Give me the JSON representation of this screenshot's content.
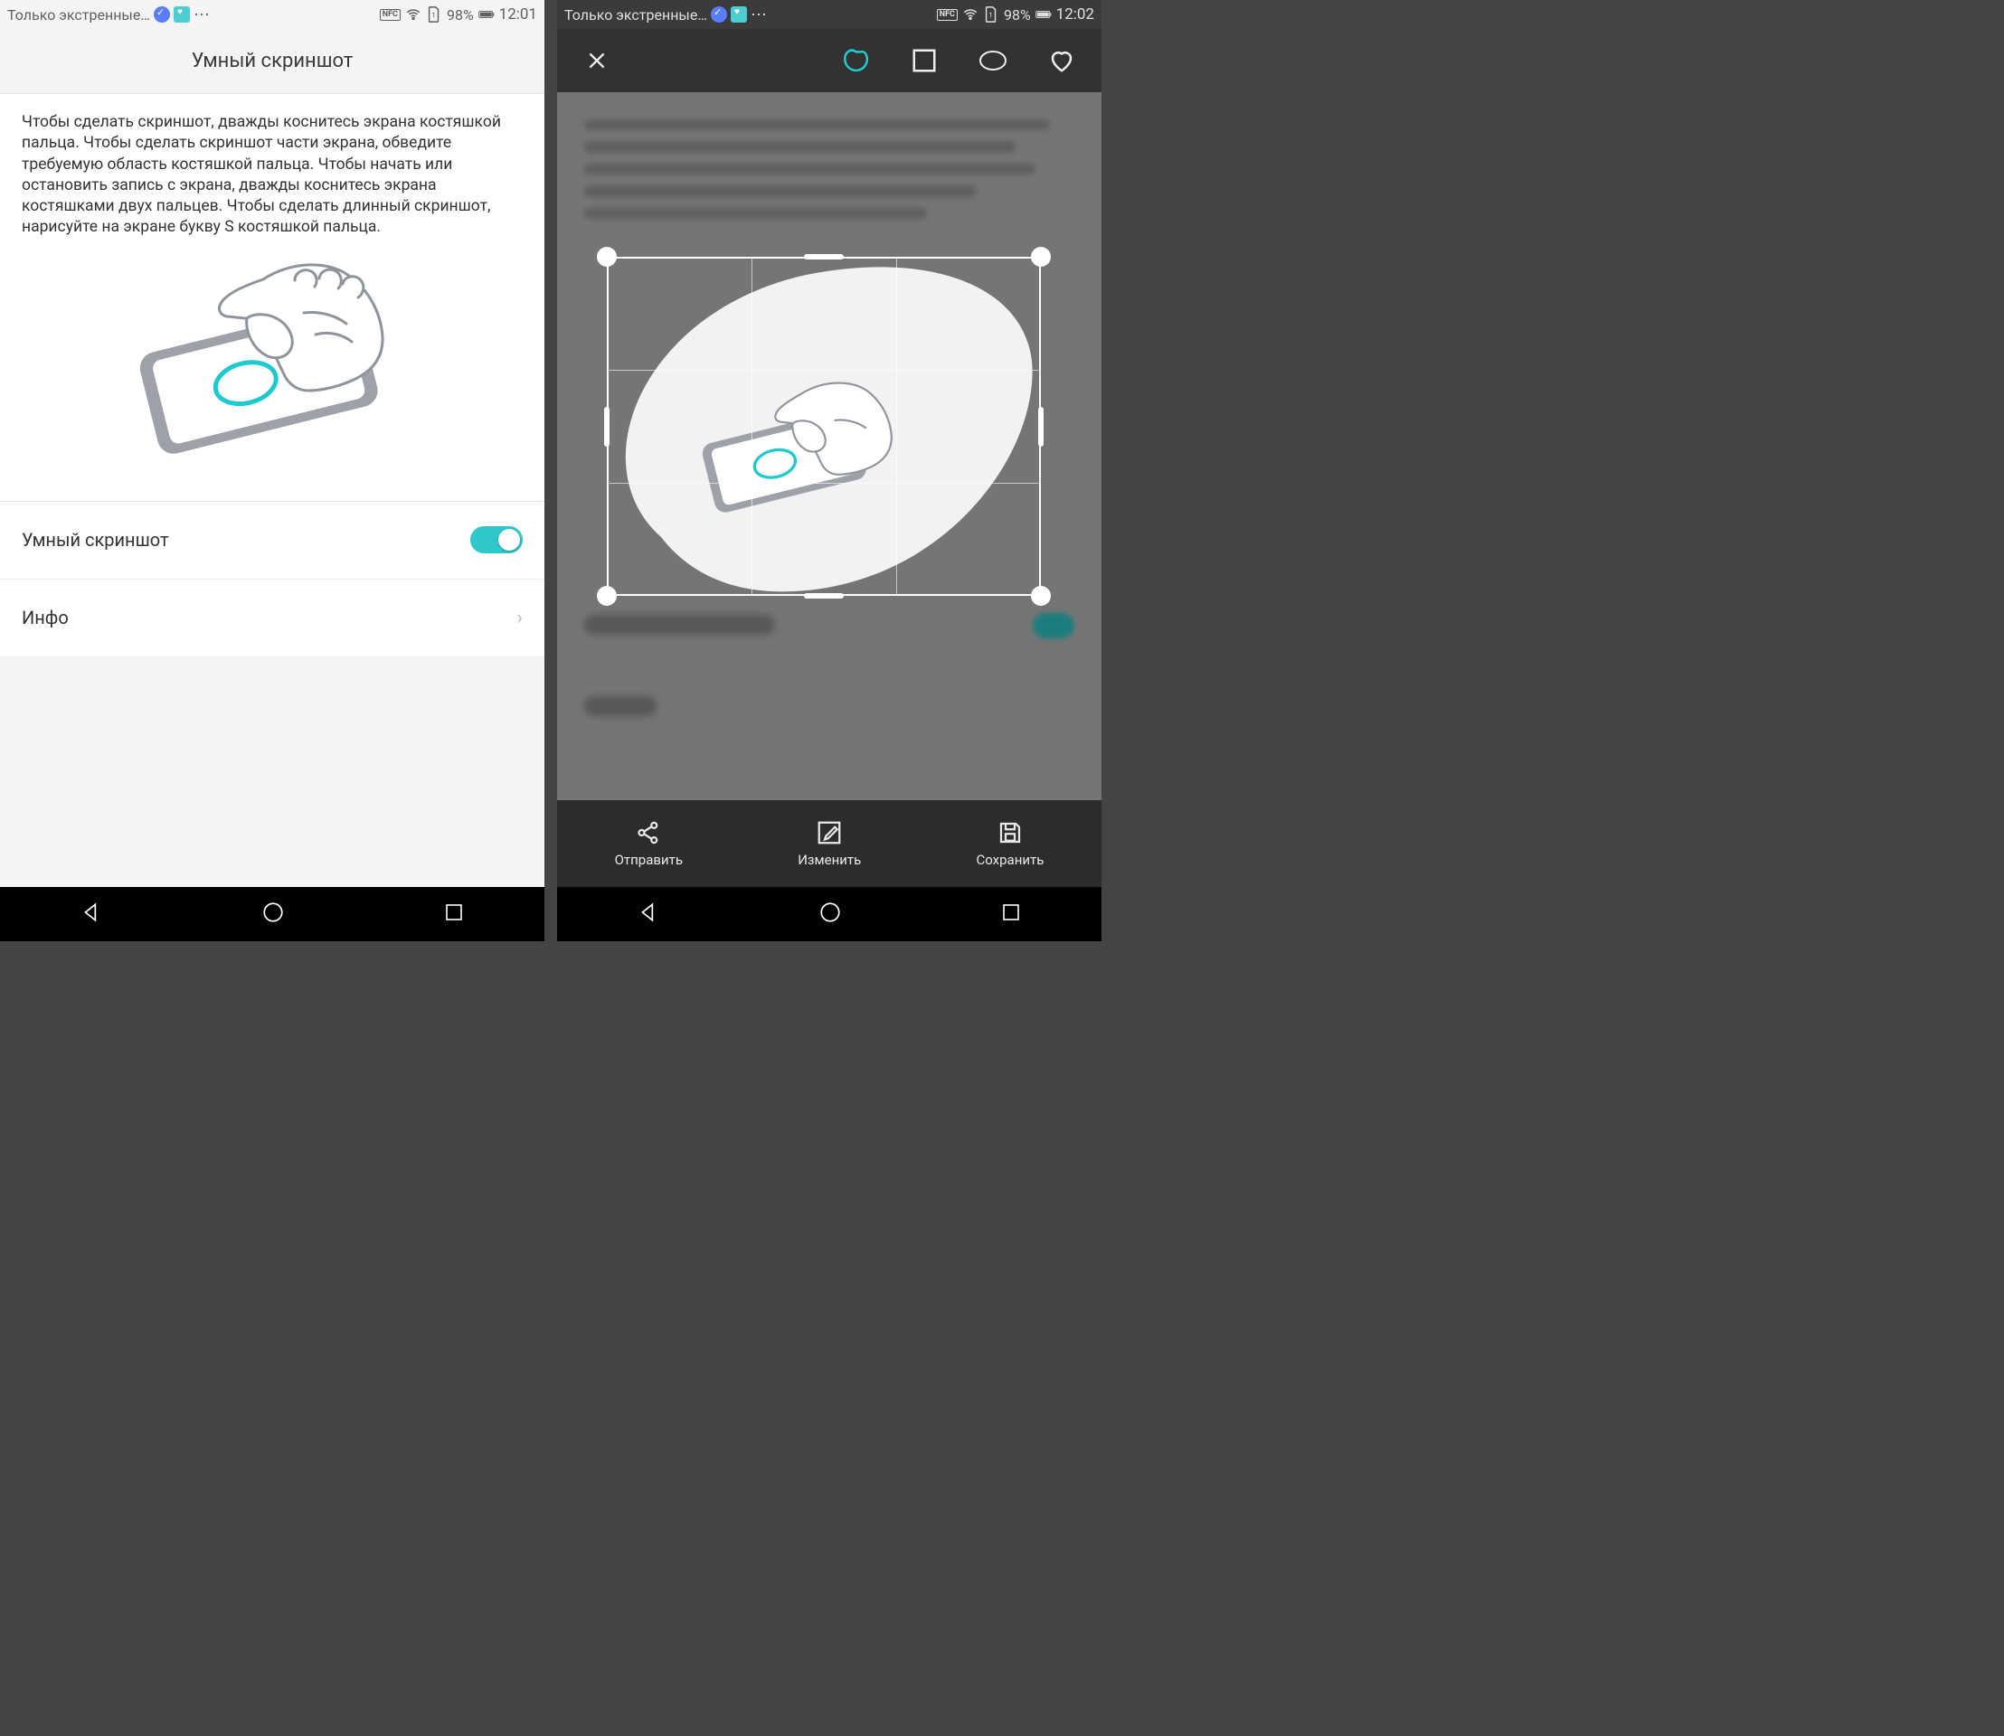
{
  "left": {
    "status": {
      "carrier": "Только экстренные…",
      "nfc": "NFC",
      "battery": "98%",
      "time": "12:01"
    },
    "header": {
      "title": "Умный скриншот"
    },
    "description": "Чтобы сделать скриншот, дважды коснитесь экрана костяшкой пальца. Чтобы сделать скриншот части экрана, обведите требуемую область костяшкой пальца. Чтобы начать или остановить запись с экрана, дважды коснитесь экрана костяшками двух пальцев. Чтобы сделать длинный скриншот, нарисуйте на экране букву S костяшкой пальца.",
    "rows": {
      "toggle_label": "Умный скриншот",
      "toggle_on": true,
      "info_label": "Инфо"
    }
  },
  "right": {
    "status": {
      "carrier": "Только экстренные…",
      "nfc": "NFC",
      "battery": "98%",
      "time": "12:02"
    },
    "toolbar": {
      "close_icon": "close",
      "shapes": [
        "freeform",
        "square",
        "ellipse",
        "heart"
      ],
      "active_shape": "freeform"
    },
    "actions": {
      "share": "Отправить",
      "edit": "Изменить",
      "save": "Сохранить"
    }
  }
}
